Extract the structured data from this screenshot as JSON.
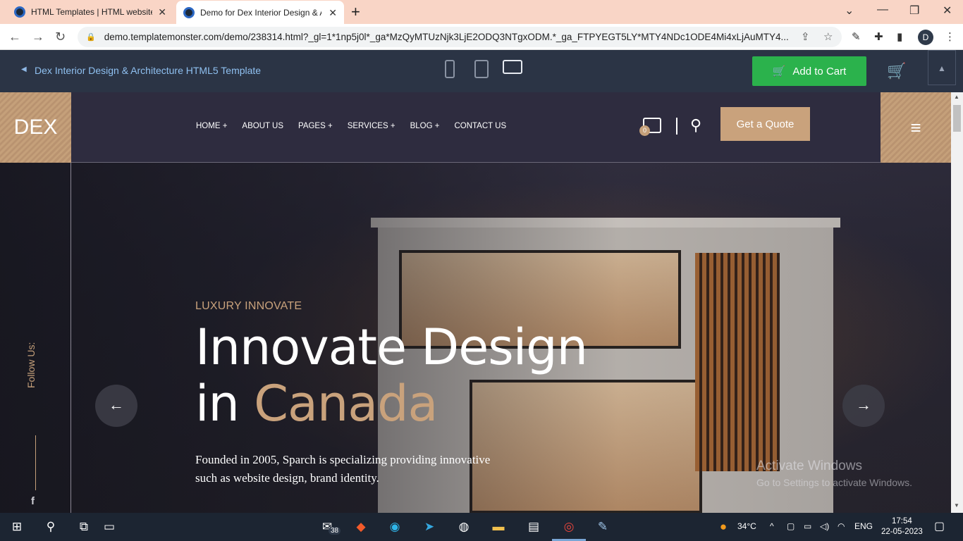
{
  "browser": {
    "tabs": [
      {
        "title": "HTML Templates | HTML website",
        "active": false
      },
      {
        "title": "Demo for Dex Interior Design & A",
        "active": true
      }
    ],
    "url": "demo.templatemonster.com/demo/238314.html?_gl=1*1np5j0l*_ga*MzQyMTUzNjk3LjE2ODQ3NTgxODM.*_ga_FTPYEGT5LY*MTY4NDc1ODE4Mi4xLjAuMTY4...",
    "profile_initial": "D"
  },
  "tm_bar": {
    "title": "Dex Interior Design & Architecture HTML5 Template",
    "add_to_cart": "Add to Cart",
    "colors": {
      "bar": "#2b3445",
      "button": "#2bb24c"
    }
  },
  "site": {
    "logo": "DEX",
    "menu": [
      "HOME +",
      "ABOUT US",
      "PAGES +",
      "SERVICES +",
      "BLOG +",
      "CONTACT US"
    ],
    "cart_count": "0",
    "quote_button": "Get a Quote",
    "follow_us": "Follow Us:",
    "hero": {
      "subtitle": "LUXURY INNOVATE",
      "headline_line1": "Innovate Design",
      "headline_line2_prefix": "in ",
      "headline_line2_accent": "Canada",
      "description": "Founded in 2005, Sparch is specializing providing innovative such as website design, brand identity."
    },
    "accent_color": "#c9a27c"
  },
  "watermark": {
    "title": "Activate Windows",
    "subtitle": "Go to Settings to activate Windows."
  },
  "taskbar": {
    "mail_badge": "38",
    "weather": "34°C",
    "language": "ENG",
    "time": "17:54",
    "date": "22-05-2023"
  }
}
